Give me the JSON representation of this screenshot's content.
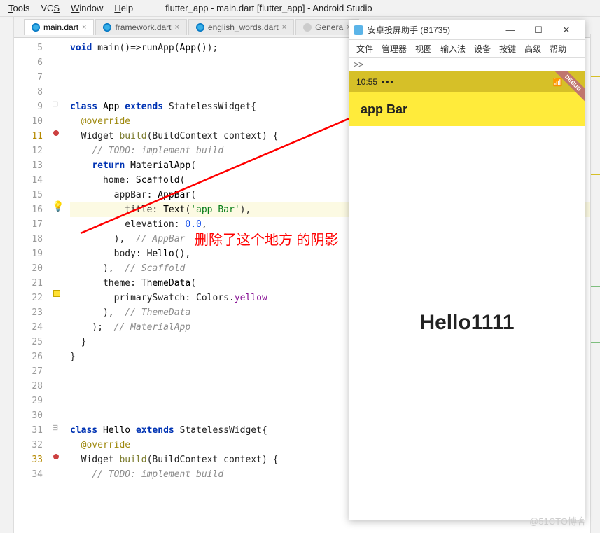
{
  "menubar": {
    "tools": "Tools",
    "vcs": "VCS",
    "window": "Window",
    "help": "Help"
  },
  "app_title": "flutter_app - main.dart [flutter_app] - Android Studio",
  "tabs": [
    {
      "label": "main.dart",
      "active": true
    },
    {
      "label": "framework.dart",
      "active": false
    },
    {
      "label": "english_words.dart",
      "active": false
    },
    {
      "label": "Genera",
      "active": false
    }
  ],
  "lines": [
    {
      "n": "5",
      "code": [
        {
          "t": "void ",
          "c": "kw"
        },
        {
          "t": "main()=>runApp(",
          "c": ""
        },
        {
          "t": "App",
          "c": "cls"
        },
        {
          "t": "());",
          "c": ""
        }
      ]
    },
    {
      "n": "6",
      "code": []
    },
    {
      "n": "7",
      "code": []
    },
    {
      "n": "8",
      "code": []
    },
    {
      "n": "9",
      "code": [
        {
          "t": "class ",
          "c": "kw"
        },
        {
          "t": "App ",
          "c": "cls"
        },
        {
          "t": "extends ",
          "c": "kw"
        },
        {
          "t": "StatelessWidget{",
          "c": ""
        }
      ]
    },
    {
      "n": "10",
      "code": [
        {
          "t": "  ",
          "c": ""
        },
        {
          "t": "@override",
          "c": "anno"
        }
      ]
    },
    {
      "n": "11",
      "marked": true,
      "code": [
        {
          "t": "  Widget ",
          "c": ""
        },
        {
          "t": "build",
          "c": "fn"
        },
        {
          "t": "(BuildContext context) {",
          "c": ""
        }
      ]
    },
    {
      "n": "12",
      "code": [
        {
          "t": "    ",
          "c": ""
        },
        {
          "t": "// TODO: implement build",
          "c": "cmt"
        }
      ]
    },
    {
      "n": "13",
      "code": [
        {
          "t": "    ",
          "c": ""
        },
        {
          "t": "return ",
          "c": "kw"
        },
        {
          "t": "MaterialApp",
          "c": "cls"
        },
        {
          "t": "(",
          "c": ""
        }
      ]
    },
    {
      "n": "14",
      "code": [
        {
          "t": "      home: ",
          "c": ""
        },
        {
          "t": "Scaffold",
          "c": "cls"
        },
        {
          "t": "(",
          "c": ""
        }
      ]
    },
    {
      "n": "15",
      "code": [
        {
          "t": "        appBar: ",
          "c": ""
        },
        {
          "t": "AppBar",
          "c": "cls"
        },
        {
          "t": "(",
          "c": ""
        }
      ]
    },
    {
      "n": "16",
      "hl": true,
      "code": [
        {
          "t": "          title: ",
          "c": ""
        },
        {
          "t": "Text",
          "c": "cls"
        },
        {
          "t": "(",
          "c": ""
        },
        {
          "t": "'app Bar'",
          "c": "str"
        },
        {
          "t": "),",
          "c": ""
        }
      ]
    },
    {
      "n": "17",
      "code": [
        {
          "t": "          elevation: ",
          "c": ""
        },
        {
          "t": "0.0",
          "c": "num"
        },
        {
          "t": ",",
          "c": ""
        }
      ]
    },
    {
      "n": "18",
      "code": [
        {
          "t": "        ),  ",
          "c": ""
        },
        {
          "t": "// AppBar",
          "c": "cmt"
        }
      ]
    },
    {
      "n": "19",
      "code": [
        {
          "t": "        body: ",
          "c": ""
        },
        {
          "t": "Hello",
          "c": "cls"
        },
        {
          "t": "(),",
          "c": ""
        }
      ]
    },
    {
      "n": "20",
      "code": [
        {
          "t": "      ),  ",
          "c": ""
        },
        {
          "t": "// Scaffold",
          "c": "cmt"
        }
      ]
    },
    {
      "n": "21",
      "code": [
        {
          "t": "      theme: ",
          "c": ""
        },
        {
          "t": "ThemeData",
          "c": "cls"
        },
        {
          "t": "(",
          "c": ""
        }
      ]
    },
    {
      "n": "22",
      "code": [
        {
          "t": "        primarySwatch: Colors.",
          "c": ""
        },
        {
          "t": "yellow",
          "c": "field"
        }
      ]
    },
    {
      "n": "23",
      "code": [
        {
          "t": "      ),  ",
          "c": ""
        },
        {
          "t": "// ThemeData",
          "c": "cmt"
        }
      ]
    },
    {
      "n": "24",
      "code": [
        {
          "t": "    );  ",
          "c": ""
        },
        {
          "t": "// MaterialApp",
          "c": "cmt"
        }
      ]
    },
    {
      "n": "25",
      "code": [
        {
          "t": "  }",
          "c": ""
        }
      ]
    },
    {
      "n": "26",
      "code": [
        {
          "t": "}",
          "c": ""
        }
      ]
    },
    {
      "n": "27",
      "code": []
    },
    {
      "n": "28",
      "code": []
    },
    {
      "n": "29",
      "code": []
    },
    {
      "n": "30",
      "code": []
    },
    {
      "n": "31",
      "code": [
        {
          "t": "class ",
          "c": "kw"
        },
        {
          "t": "Hello ",
          "c": "cls"
        },
        {
          "t": "extends ",
          "c": "kw"
        },
        {
          "t": "StatelessWidget{",
          "c": ""
        }
      ]
    },
    {
      "n": "32",
      "code": [
        {
          "t": "  ",
          "c": ""
        },
        {
          "t": "@override",
          "c": "anno"
        }
      ]
    },
    {
      "n": "33",
      "marked": true,
      "code": [
        {
          "t": "  Widget ",
          "c": ""
        },
        {
          "t": "build",
          "c": "fn"
        },
        {
          "t": "(BuildContext context) {",
          "c": ""
        }
      ]
    },
    {
      "n": "34",
      "code": [
        {
          "t": "    ",
          "c": ""
        },
        {
          "t": "// TODO: implement build",
          "c": "cmt"
        }
      ]
    }
  ],
  "phone": {
    "window_title": "安卓投屏助手 (B1735)",
    "menu": [
      "文件",
      "管理器",
      "视图",
      "输入法",
      "设备",
      "按键",
      "高级",
      "帮助"
    ],
    "prompt": ">>",
    "status_time": "10:55",
    "appbar_title": "app Bar",
    "body_text": "Hello1111"
  },
  "annotation": "删除了这个地方 的阴影",
  "watermark": "@51CTO博客"
}
